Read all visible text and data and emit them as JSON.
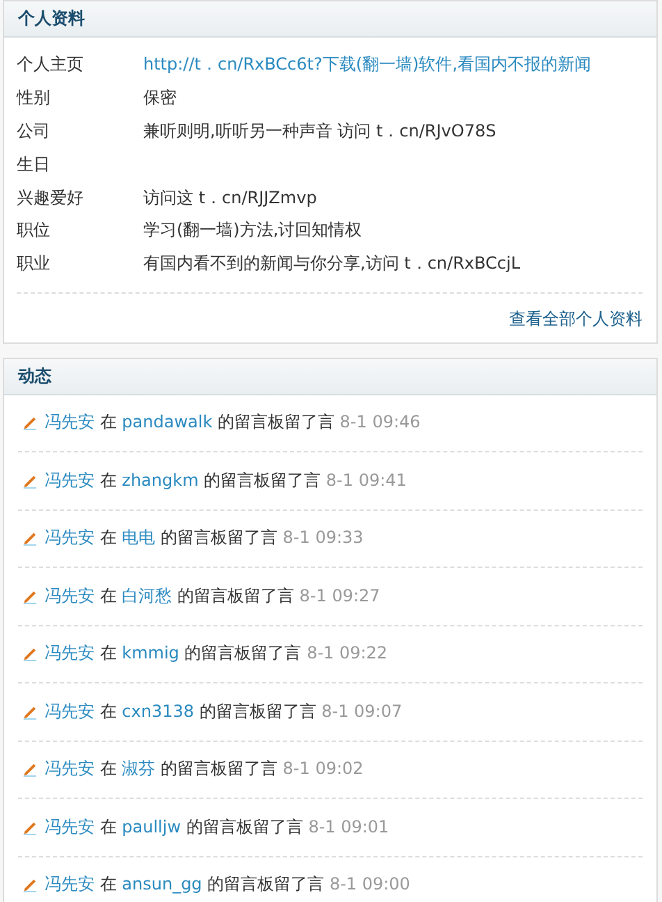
{
  "profile": {
    "title": "个人资料",
    "fields": [
      {
        "label": "个人主页",
        "value": "http://t．cn/RxBCc6t?下载(翻一墙)软件,看国内不报的新闻",
        "kind": "link"
      },
      {
        "label": "性别",
        "value": "保密",
        "kind": "text"
      },
      {
        "label": "公司",
        "value": "兼听则明,听听另一种声音 访问 t．cn/RJvO78S",
        "kind": "text"
      },
      {
        "label": "生日"
      },
      {
        "label": "兴趣爱好",
        "value": "访问这 t．cn/RJJZmvp",
        "kind": "text"
      },
      {
        "label": "职位",
        "value": "学习(翻一墙)方法,讨回知情权",
        "kind": "text"
      },
      {
        "label": "职业",
        "value": "有国内看不到的新闻与你分享,访问 t．cn/RxBCcjL",
        "kind": "text"
      }
    ],
    "more_link": "查看全部个人资料"
  },
  "activity": {
    "title": "动态",
    "items": [
      {
        "actor": "冯先安",
        "preposition": "在",
        "target": "pandawalk",
        "action": "的留言板留了言",
        "time": "8-1 09:46"
      },
      {
        "actor": "冯先安",
        "preposition": "在",
        "target": "zhangkm",
        "action": "的留言板留了言",
        "time": "8-1 09:41"
      },
      {
        "actor": "冯先安",
        "preposition": "在",
        "target": "电电",
        "action": "的留言板留了言",
        "time": "8-1 09:33"
      },
      {
        "actor": "冯先安",
        "preposition": "在",
        "target": "白河愁",
        "action": "的留言板留了言",
        "time": "8-1 09:27"
      },
      {
        "actor": "冯先安",
        "preposition": "在",
        "target": "kmmig",
        "action": "的留言板留了言",
        "time": "8-1 09:22"
      },
      {
        "actor": "冯先安",
        "preposition": "在",
        "target": "cxn3138",
        "action": "的留言板留了言",
        "time": "8-1 09:07"
      },
      {
        "actor": "冯先安",
        "preposition": "在",
        "target": "淑芬",
        "action": "的留言板留了言",
        "time": "8-1 09:02"
      },
      {
        "actor": "冯先安",
        "preposition": "在",
        "target": "paulljw",
        "action": "的留言板留了言",
        "time": "8-1 09:01"
      },
      {
        "actor": "冯先安",
        "preposition": "在",
        "target": "ansun_gg",
        "action": "的留言板留了言",
        "time": "8-1 09:00"
      }
    ]
  }
}
